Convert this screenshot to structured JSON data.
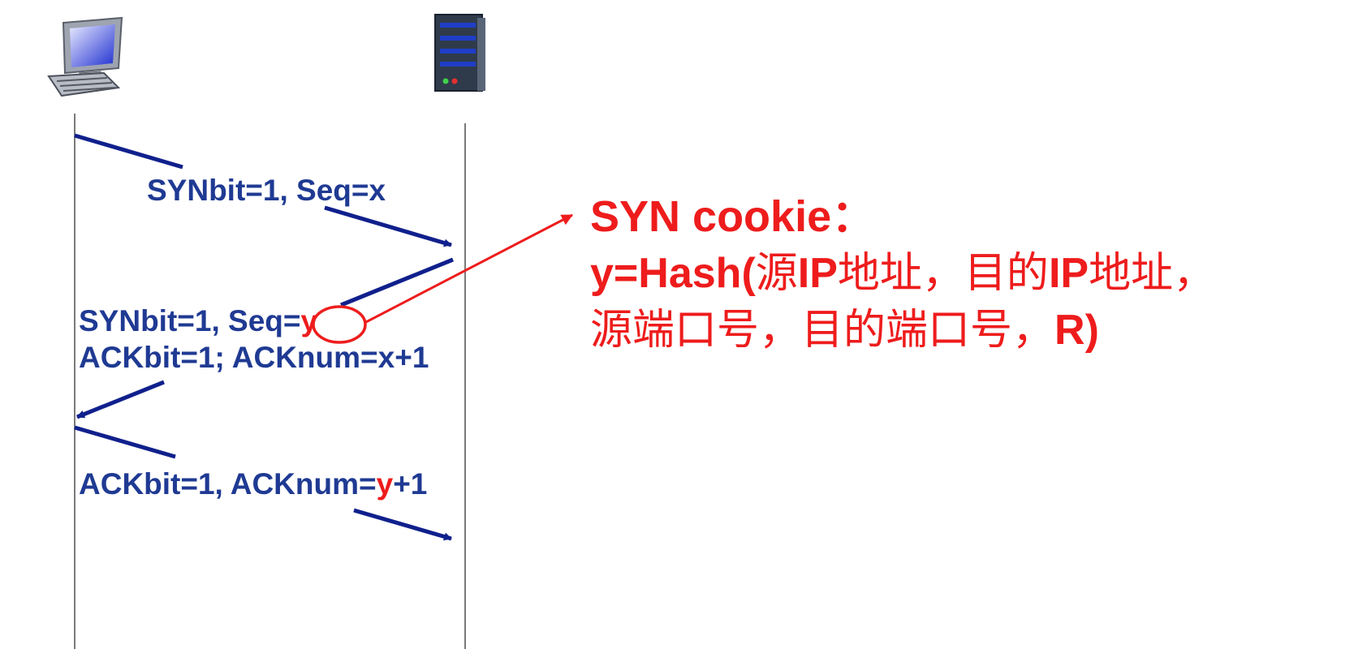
{
  "messages": {
    "syn": "SYNbit=1, Seq=x",
    "synack_line1_prefix": "SYNbit=1, Seq=",
    "synack_line1_y": "y",
    "synack_line2": "ACKbit=1; ACKnum=x+1",
    "ack_prefix": "ACKbit=1, ACKnum=",
    "ack_y": "y",
    "ack_suffix": "+1"
  },
  "note": {
    "title": "SYN cookie：",
    "line1_hash": "y=Hash(",
    "line1_src": "源",
    "line1_ip1": "IP",
    "line1_addr1": "地址，目的",
    "line1_ip2": "IP",
    "line1_addr2": "地址，",
    "line2_text": "源端口号，目的端口号，",
    "line2_end": "R)"
  },
  "icons": {
    "client": "desktop-computer-icon",
    "server": "server-tower-icon"
  },
  "colors": {
    "message": "#1f3a93",
    "arrow": "#10208c",
    "highlight": "#ee1c1c",
    "timeline": "#7a7a7a"
  }
}
